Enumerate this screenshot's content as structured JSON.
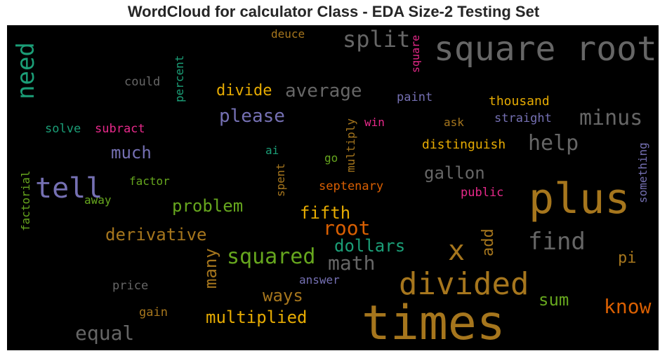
{
  "chart_data": {
    "type": "wordcloud",
    "title": "WordCloud for calculator Class - EDA Size-2 Testing Set",
    "background": "#000000",
    "words": [
      {
        "text": "times",
        "color": "#a6761d"
      },
      {
        "text": "square root",
        "color": "#666666"
      },
      {
        "text": "plus",
        "color": "#a6761d"
      },
      {
        "text": "divided",
        "color": "#a6761d"
      },
      {
        "text": "tell",
        "color": "#7570b3"
      },
      {
        "text": "x",
        "color": "#a6761d"
      },
      {
        "text": "need",
        "color": "#1b9e77"
      },
      {
        "text": "find",
        "color": "#666666"
      },
      {
        "text": "split",
        "color": "#666666"
      },
      {
        "text": "know",
        "color": "#d95f02"
      },
      {
        "text": "minus",
        "color": "#666666"
      },
      {
        "text": "help",
        "color": "#666666"
      },
      {
        "text": "squared",
        "color": "#66a61e"
      },
      {
        "text": "equal",
        "color": "#666666"
      },
      {
        "text": "math",
        "color": "#666666"
      },
      {
        "text": "root",
        "color": "#d95f02"
      },
      {
        "text": "average",
        "color": "#666666"
      },
      {
        "text": "derivative",
        "color": "#a6761d"
      },
      {
        "text": "much",
        "color": "#7570b3"
      },
      {
        "text": "please",
        "color": "#7570b3"
      },
      {
        "text": "gallon",
        "color": "#666666"
      },
      {
        "text": "problem",
        "color": "#66a61e"
      },
      {
        "text": "divide",
        "color": "#e6ab02"
      },
      {
        "text": "fifth",
        "color": "#e6ab02"
      },
      {
        "text": "dollars",
        "color": "#1b9e77"
      },
      {
        "text": "multiplied",
        "color": "#e6ab02"
      },
      {
        "text": "many",
        "color": "#a6761d"
      },
      {
        "text": "ways",
        "color": "#a6761d"
      },
      {
        "text": "sum",
        "color": "#66a61e"
      },
      {
        "text": "add",
        "color": "#a6761d"
      },
      {
        "text": "pi",
        "color": "#a6761d"
      },
      {
        "text": "thousand",
        "color": "#e6ab02"
      },
      {
        "text": "distinguish",
        "color": "#e6ab02"
      },
      {
        "text": "septenary",
        "color": "#d95f02"
      },
      {
        "text": "straight",
        "color": "#7570b3"
      },
      {
        "text": "paint",
        "color": "#7570b3"
      },
      {
        "text": "public",
        "color": "#e7298a"
      },
      {
        "text": "answer",
        "color": "#7570b3"
      },
      {
        "text": "price",
        "color": "#666666"
      },
      {
        "text": "gain",
        "color": "#a6761d"
      },
      {
        "text": "solve",
        "color": "#1b9e77"
      },
      {
        "text": "subract",
        "color": "#e7298a"
      },
      {
        "text": "could",
        "color": "#666666"
      },
      {
        "text": "percent",
        "color": "#1b9e77"
      },
      {
        "text": "deuce",
        "color": "#a6761d"
      },
      {
        "text": "square",
        "color": "#e7298a"
      },
      {
        "text": "win",
        "color": "#e7298a"
      },
      {
        "text": "ask",
        "color": "#a6761d"
      },
      {
        "text": "multiply",
        "color": "#a6761d"
      },
      {
        "text": "go",
        "color": "#66a61e"
      },
      {
        "text": "ai",
        "color": "#1b9e77"
      },
      {
        "text": "spent",
        "color": "#a6761d"
      },
      {
        "text": "factor",
        "color": "#66a61e"
      },
      {
        "text": "away",
        "color": "#66a61e"
      },
      {
        "text": "factorial",
        "color": "#66a61e"
      },
      {
        "text": "something",
        "color": "#7570b3"
      }
    ]
  }
}
